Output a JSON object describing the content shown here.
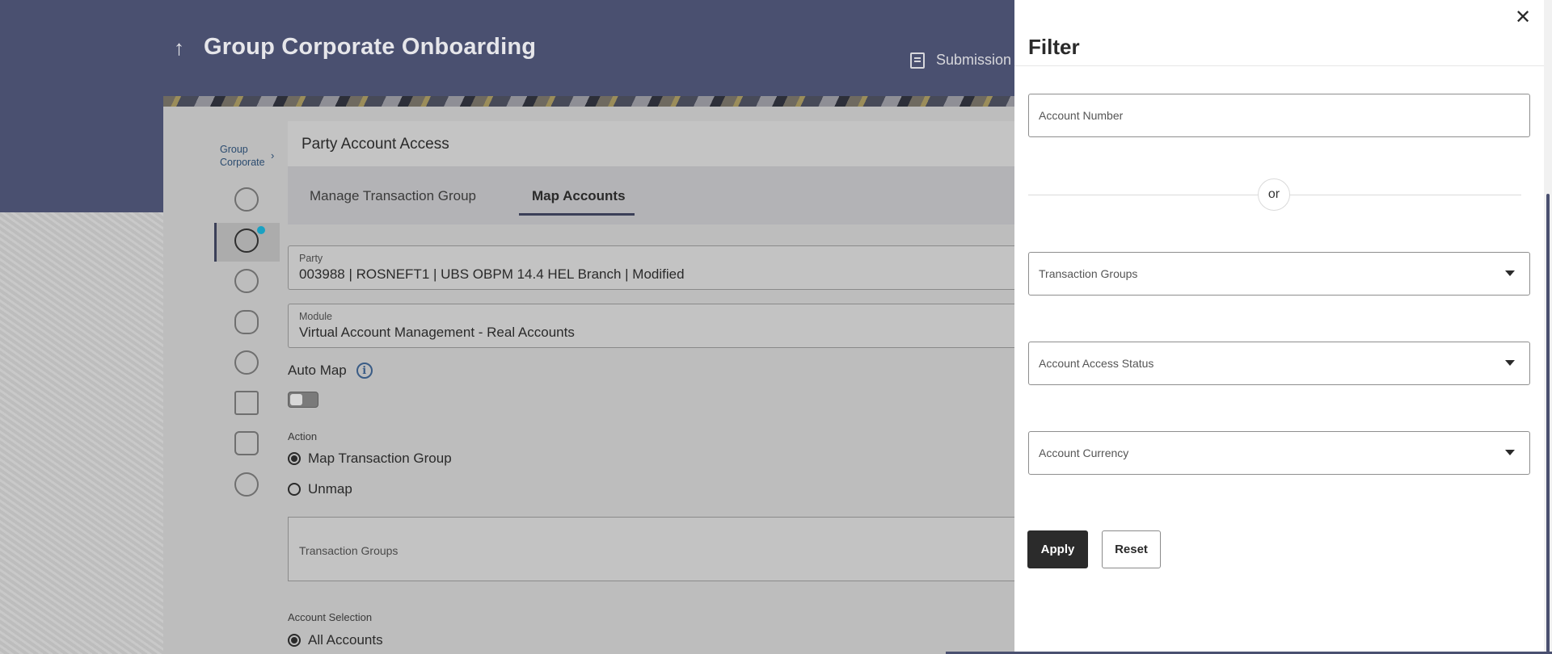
{
  "app": {
    "title": "Group Corporate Onboarding",
    "submission_label": "Submission"
  },
  "nav": {
    "breadcrumb": "Group Corporate",
    "icons": [
      "globe-icon",
      "globe-user-icon",
      "badge-icon",
      "users-icon",
      "user-gear-icon",
      "document-icon",
      "workflow-icon",
      "group-gear-icon"
    ]
  },
  "card": {
    "title": "Party Account Access",
    "tabs": [
      {
        "label": "Manage Transaction Group",
        "active": false
      },
      {
        "label": "Map Accounts",
        "active": true
      }
    ],
    "party": {
      "label": "Party",
      "value": "003988 | ROSNEFT1 | UBS OBPM 14.4 HEL Branch | Modified"
    },
    "module": {
      "label": "Module",
      "value": "Virtual Account Management - Real Accounts"
    },
    "auto_map_label": "Auto Map",
    "auto_map_on": false,
    "action_label": "Action",
    "actions": [
      {
        "label": "Map Transaction Group",
        "checked": true
      },
      {
        "label": "Unmap",
        "checked": false
      }
    ],
    "transaction_groups_label": "Transaction Groups",
    "account_selection_label": "Account Selection",
    "account_selection": {
      "label": "All Accounts",
      "checked": true
    }
  },
  "filter": {
    "title": "Filter",
    "account_number_placeholder": "Account Number",
    "or_label": "or",
    "transaction_groups_placeholder": "Transaction Groups",
    "account_access_status_placeholder": "Account Access Status",
    "account_currency_placeholder": "Account Currency",
    "apply_label": "Apply",
    "reset_label": "Reset"
  }
}
